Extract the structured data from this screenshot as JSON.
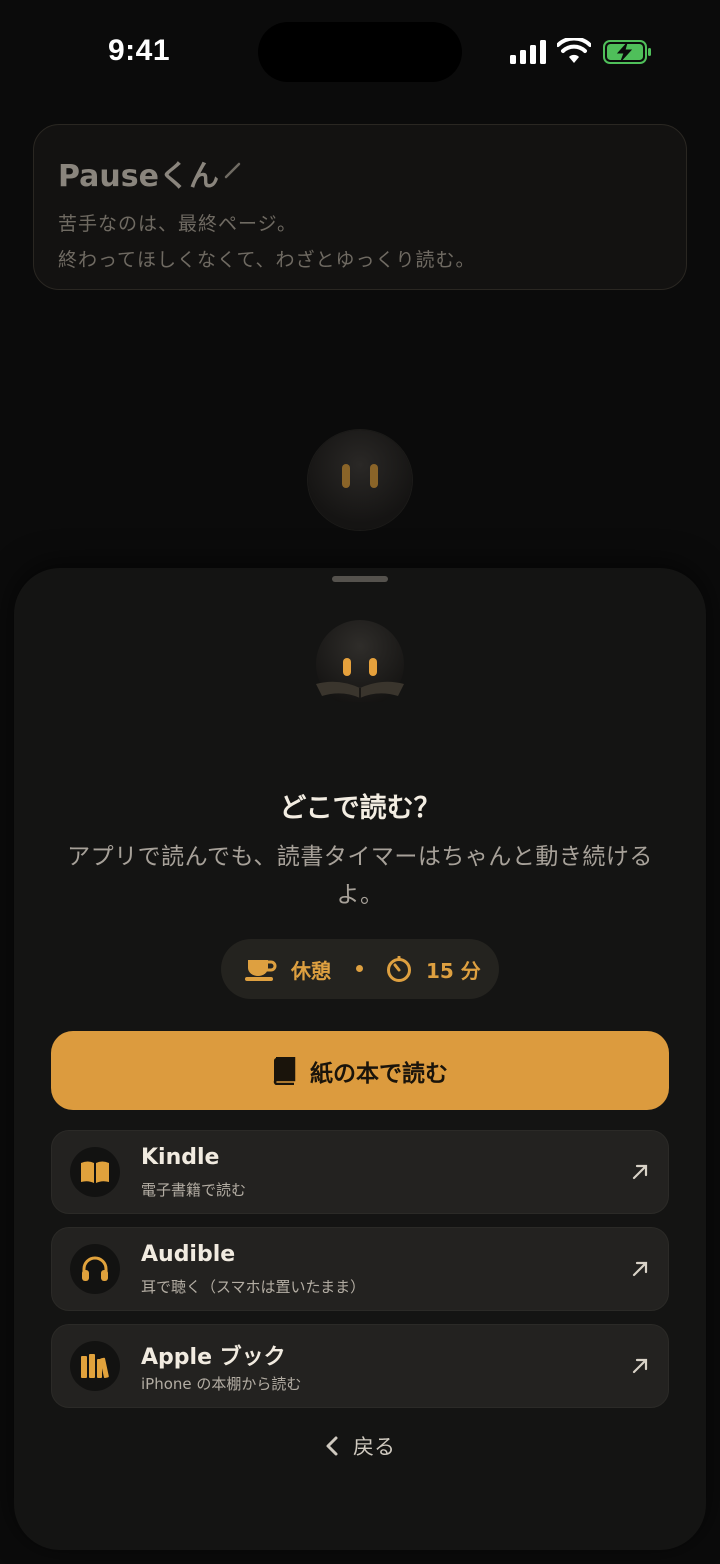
{
  "status_bar": {
    "time": "9:41"
  },
  "profile": {
    "name": "Pauseくん",
    "line1": "苦手なのは、最終ページ。",
    "line2": "終わってほしくなくて、わざとゆっくり読む。"
  },
  "sheet": {
    "title": "どこで読む？",
    "subtitle": "アプリで読んでも、読書タイマーはちゃんと動き続けるよ。",
    "pill": {
      "break_label": "休憩",
      "timer_label": "15 分"
    },
    "primary_label": "紙の本で読む",
    "options": [
      {
        "title": "Kindle",
        "subtitle": "電子書籍で読む",
        "icon": "open-book-icon"
      },
      {
        "title": "Audible",
        "subtitle": "耳で聴く（スマホは置いたまま）",
        "icon": "headphones-icon"
      },
      {
        "title": "Apple ブック",
        "subtitle": "iPhone の本棚から読む",
        "icon": "bookshelf-icon"
      }
    ],
    "back_label": "戻る"
  },
  "colors": {
    "accent": "#dc9b3e",
    "background": "#0b0b0b",
    "sheet": "#141413"
  }
}
